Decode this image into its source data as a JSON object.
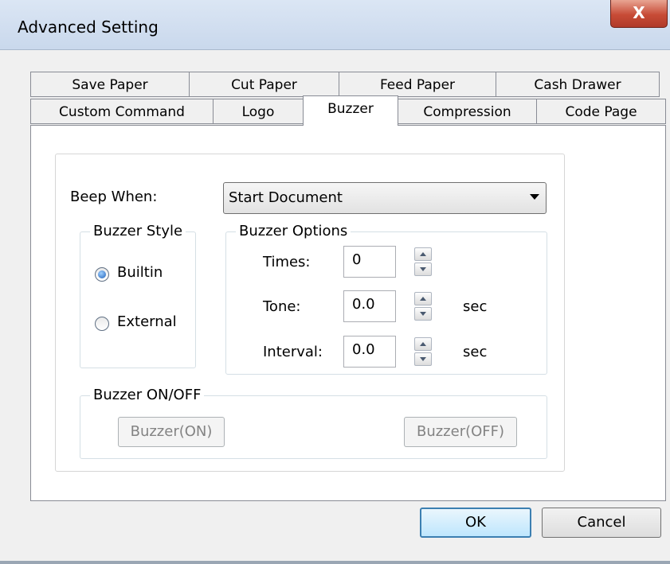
{
  "window": {
    "title": "Advanced Setting",
    "close_label": "X"
  },
  "tabs": {
    "row1": [
      {
        "label": "Save Paper"
      },
      {
        "label": "Cut Paper"
      },
      {
        "label": "Feed Paper"
      },
      {
        "label": "Cash Drawer"
      }
    ],
    "row2": [
      {
        "label": "Custom Command"
      },
      {
        "label": "Logo"
      },
      {
        "label": "Buzzer",
        "active": true
      },
      {
        "label": "Compression"
      },
      {
        "label": "Code Page"
      }
    ]
  },
  "buzzer": {
    "beep_when_label": "Beep When:",
    "beep_when_value": "Start Document",
    "style": {
      "legend": "Buzzer Style",
      "options": [
        {
          "label": "Builtin",
          "checked": true
        },
        {
          "label": "External",
          "checked": false
        }
      ]
    },
    "options": {
      "legend": "Buzzer Options",
      "times_label": "Times:",
      "times_value": "0",
      "tone_label": "Tone:",
      "tone_value": "0.0",
      "tone_unit": "sec",
      "interval_label": "Interval:",
      "interval_value": "0.0",
      "interval_unit": "sec"
    },
    "onoff": {
      "legend": "Buzzer ON/OFF",
      "on_label": "Buzzer(ON)",
      "off_label": "Buzzer(OFF)"
    }
  },
  "footer": {
    "ok_label": "OK",
    "cancel_label": "Cancel"
  }
}
